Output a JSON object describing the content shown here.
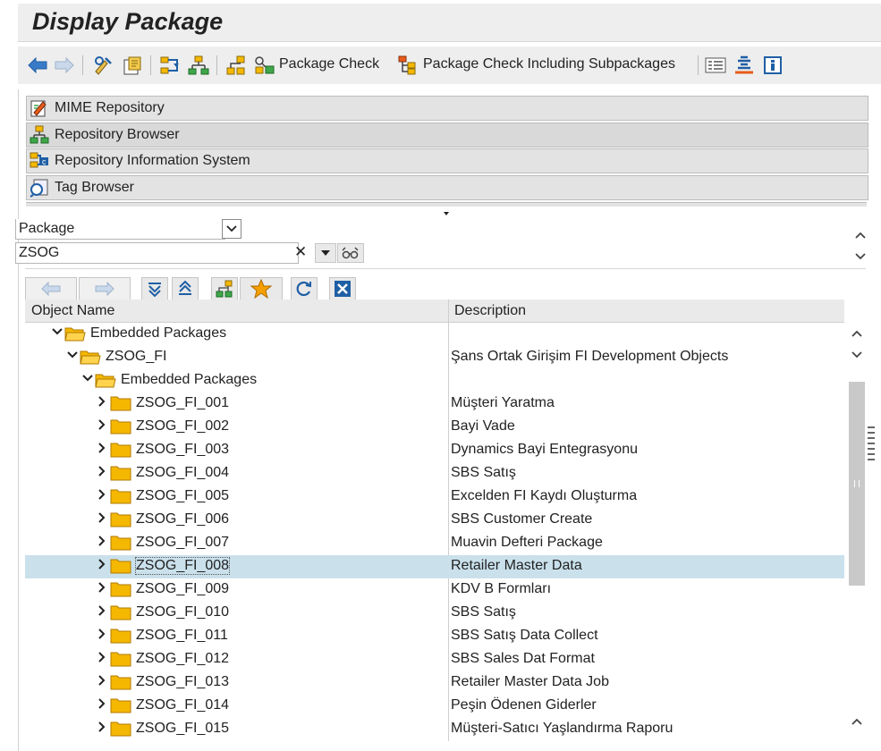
{
  "window": {
    "title": "Display Package"
  },
  "toolbar": {
    "package_check_label": "Package Check",
    "package_check_sub_label": "Package Check Including Subpackages"
  },
  "nav": {
    "items": [
      {
        "label": "MIME Repository",
        "icon": "mime-icon"
      },
      {
        "label": "Repository Browser",
        "icon": "repository-browser-icon"
      },
      {
        "label": "Repository Information System",
        "icon": "info-system-icon"
      },
      {
        "label": "Tag Browser",
        "icon": "tag-browser-icon"
      }
    ]
  },
  "selector": {
    "object_type": "Package",
    "object_value": "ZSOG"
  },
  "tree": {
    "columns": {
      "name": "Object Name",
      "description": "Description"
    },
    "rows": [
      {
        "name": "Embedded Packages",
        "description": ""
      },
      {
        "name": "ZSOG_FI",
        "description": "Şans Ortak Girişim FI Development Objects"
      },
      {
        "name": "Embedded Packages",
        "description": ""
      },
      {
        "name": "ZSOG_FI_001",
        "description": "Müşteri Yaratma"
      },
      {
        "name": "ZSOG_FI_002",
        "description": "Bayi Vade"
      },
      {
        "name": "ZSOG_FI_003",
        "description": "Dynamics Bayi Entegrasyonu"
      },
      {
        "name": "ZSOG_FI_004",
        "description": "SBS Satış"
      },
      {
        "name": "ZSOG_FI_005",
        "description": "Excelden FI Kaydı Oluşturma"
      },
      {
        "name": "ZSOG_FI_006",
        "description": "SBS Customer Create"
      },
      {
        "name": "ZSOG_FI_007",
        "description": "Muavin Defteri Package"
      },
      {
        "name": "ZSOG_FI_008",
        "description": "Retailer Master Data"
      },
      {
        "name": "ZSOG_FI_009",
        "description": "KDV B Formları"
      },
      {
        "name": "ZSOG_FI_010",
        "description": "SBS Satış"
      },
      {
        "name": "ZSOG_FI_011",
        "description": "SBS Satış Data Collect"
      },
      {
        "name": "ZSOG_FI_012",
        "description": "SBS Sales Dat Format"
      },
      {
        "name": "ZSOG_FI_013",
        "description": "Retailer Master Data Job"
      },
      {
        "name": "ZSOG_FI_014",
        "description": "Peşin Ödenen Giderler"
      },
      {
        "name": "ZSOG_FI_015",
        "description": "Müşteri-Satıcı Yaşlandırma Raporu"
      }
    ]
  },
  "colors": {
    "accent": "#1f5fa5",
    "folder": "#f5b800",
    "selected_row": "#cae1ec"
  }
}
